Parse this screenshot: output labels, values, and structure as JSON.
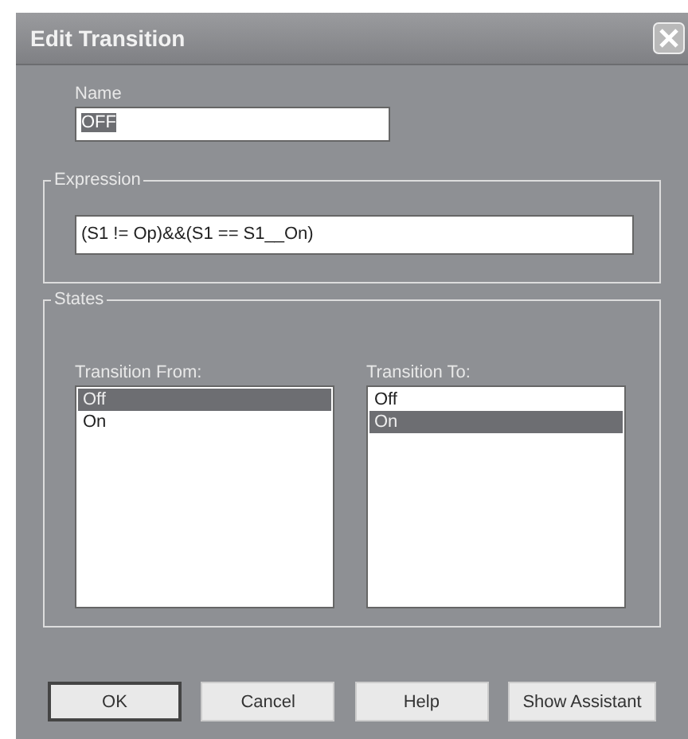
{
  "window": {
    "title": "Edit Transition"
  },
  "name_field": {
    "label": "Name",
    "value": "OFF",
    "selected": true
  },
  "expression": {
    "group": "Expression",
    "value": "(S1 != Op)&&(S1 == S1__On)"
  },
  "states": {
    "group": "States",
    "lists": [
      {
        "label": "Transition From:",
        "items": [
          {
            "text": "Off",
            "selected": true
          },
          {
            "text": "On",
            "selected": false
          }
        ]
      },
      {
        "label": "Transition To:",
        "items": [
          {
            "text": "Off",
            "selected": false
          },
          {
            "text": "On",
            "selected": true
          }
        ]
      }
    ]
  },
  "buttons": [
    {
      "label": "OK",
      "default": true
    },
    {
      "label": "Cancel",
      "default": false
    },
    {
      "label": "Help",
      "default": false
    },
    {
      "label": "Show Assistant",
      "default": false
    }
  ]
}
